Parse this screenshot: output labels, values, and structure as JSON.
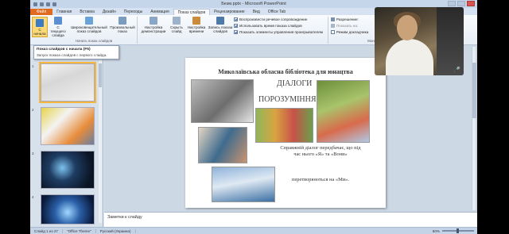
{
  "window": {
    "title": "Безм.pptx - Microsoft PowerPoint"
  },
  "tabs": [
    {
      "label": "Файл",
      "kind": "file"
    },
    {
      "label": "Главная"
    },
    {
      "label": "Вставка"
    },
    {
      "label": "Дизайн"
    },
    {
      "label": "Переходы"
    },
    {
      "label": "Анимация"
    },
    {
      "label": "Показ слайдов",
      "active": true
    },
    {
      "label": "Рецензирование"
    },
    {
      "label": "Вид"
    },
    {
      "label": "Office Tab"
    }
  ],
  "ribbon": {
    "start_group": {
      "from_start": "С начала",
      "from_current": "С текущего слайда",
      "broadcast": "Широковещательный показ слайдов",
      "custom": "Произвольный показ",
      "group_label": "Начать показ слайдов"
    },
    "setup_group": {
      "setup": "Настройка демонстрации",
      "hide": "Скрыть слайд",
      "rehearse": "Настройка времени",
      "record": "Запись показа слайдов"
    },
    "options": {
      "narration": "Воспроизвести речевое сопровождение",
      "timings": "Использовать время показа слайдов",
      "controls": "Показать элементы управления проигрывателем"
    },
    "monitors": {
      "resolution": "Разрешение:",
      "show_on": "Показать на:",
      "presenter": "Режим докладчика",
      "group_label": "Монито"
    }
  },
  "tooltip": {
    "title": "Показ слайдов с начала (F5)",
    "description": "Запуск показа слайдов с первого слайда."
  },
  "slide_pane": {
    "thumbnails": [
      {
        "number": "1",
        "selected": true
      },
      {
        "number": "2"
      },
      {
        "number": "3"
      },
      {
        "number": "4"
      }
    ]
  },
  "slide": {
    "heading": "Миколаївська обласна бібліотека для юнацтва",
    "title_word_1": "ДІАЛОГИ",
    "title_word_2": "ПОРОЗУМІННЯ",
    "quote_1": "Справжній діалог передбачає, що під час нього «Я» та «Вони»",
    "quote_2": "перетворюються на «Ми»."
  },
  "notes": {
    "placeholder": "Заметки к слайду"
  },
  "status_bar": {
    "slide_info": "Слайд 1 из 27",
    "theme": "\"Office Theme\"",
    "language": "Русский (Украина)",
    "zoom": "60%"
  }
}
